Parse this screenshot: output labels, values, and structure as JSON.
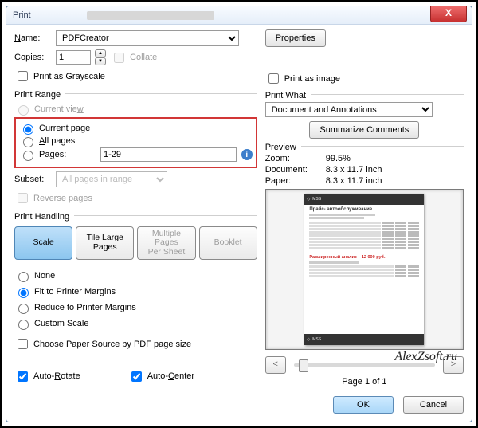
{
  "window": {
    "title": "Print",
    "close_x": "X"
  },
  "name": {
    "label": "Name:",
    "value": "PDFCreator",
    "properties_btn": "Properties"
  },
  "copies": {
    "label": "Copies:",
    "value": "1",
    "collate_label": "Collate"
  },
  "grayscale_label": "Print as Grayscale",
  "print_as_image_label": "Print as image",
  "range": {
    "group": "Print Range",
    "current_view": "Current view",
    "current_page": "Current page",
    "all_pages": "All pages",
    "pages": "Pages:",
    "pages_value": "1-29"
  },
  "subset": {
    "label": "Subset:",
    "value": "All pages in range"
  },
  "reverse_label": "Reverse pages",
  "handling": {
    "group": "Print Handling",
    "tabs": {
      "scale": "Scale",
      "tile": "Tile Large\nPages",
      "multi": "Multiple Pages\nPer Sheet",
      "booklet": "Booklet"
    },
    "none": "None",
    "fit": "Fit to Printer Margins",
    "reduce": "Reduce to Printer Margins",
    "custom": "Custom Scale",
    "paper_source": "Choose Paper Source by PDF page size",
    "auto_rotate": "Auto-Rotate",
    "auto_center": "Auto-Center"
  },
  "print_what": {
    "group": "Print What",
    "value": "Document and Annotations",
    "summarize_btn": "Summarize Comments"
  },
  "preview": {
    "group": "Preview",
    "zoom_k": "Zoom:",
    "zoom_v": "99.5%",
    "doc_k": "Document:",
    "doc_v": "8.3 x 11.7 inch",
    "paper_k": "Paper:",
    "paper_v": "8.3 x 11.7 inch",
    "prev": "<",
    "next": ">",
    "page_status": "Page 1 of 1",
    "page_title": "Прайс- автообслуживание",
    "page_red": "Расширенный анализ – 12 000 руб."
  },
  "watermark": "AlexZsoft.ru",
  "buttons": {
    "ok": "OK",
    "cancel": "Cancel"
  }
}
